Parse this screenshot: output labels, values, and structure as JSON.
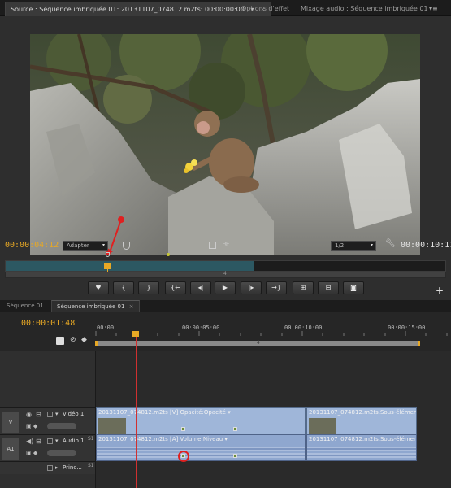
{
  "source_panel": {
    "tabs": [
      {
        "label": "Source : Séquence imbriquée 01: 20131107_074812.m2ts: 00:00:00:00",
        "active": true
      },
      {
        "label": "Options d'effet",
        "active": false
      },
      {
        "label": "Mixage audio : Séquence imbriquée 01",
        "active": false
      }
    ],
    "current_timecode": "00:00:04:12",
    "duration_timecode": "00:00:10:11",
    "zoom_select": "Adapter",
    "resolution_select": "1/2",
    "scrub_center_mark": "4",
    "icons": {
      "marker": "shield-marker-icon",
      "film": "film-icon",
      "split": "split-icon",
      "settings": "wrench-icon"
    }
  },
  "transport": {
    "buttons": [
      {
        "name": "add-marker-button",
        "glyph": "♥"
      },
      {
        "name": "mark-in-button",
        "glyph": "{"
      },
      {
        "name": "mark-out-button",
        "glyph": "}"
      },
      {
        "name": "go-to-in-button",
        "glyph": "{←"
      },
      {
        "name": "step-back-button",
        "glyph": "◂|"
      },
      {
        "name": "play-button",
        "glyph": "▶"
      },
      {
        "name": "step-forward-button",
        "glyph": "|▸"
      },
      {
        "name": "go-to-out-button",
        "glyph": "→}"
      },
      {
        "name": "insert-button",
        "glyph": "⊞"
      },
      {
        "name": "overwrite-button",
        "glyph": "⊟"
      },
      {
        "name": "export-frame-button",
        "glyph": "◙"
      }
    ],
    "add_button": "+"
  },
  "sequence_panel": {
    "tabs": [
      {
        "label": "Séquence 01",
        "active": false
      },
      {
        "label": "Séquence imbriquée 01",
        "active": true
      }
    ],
    "timecode": "00:00:01:48",
    "ruler": [
      "00:00",
      "00:00:05:00",
      "00:00:10:00",
      "00:00:15:00"
    ],
    "work_area_mark": "4",
    "tracks": {
      "video": {
        "source_label": "V",
        "name": "Vidéo 1",
        "clip1": "20131107_074812.m2ts [V]  Opacité:Opacité ▾",
        "clip2": "20131107_074812.m2ts.Sous-élément("
      },
      "audio": {
        "source_label": "A1",
        "name": "Audio 1",
        "clip1": "20131107_074812.m2ts [A]  Volume:Niveau ▾",
        "clip2": "20131107_074812.m2ts.Sous-élément("
      },
      "master": {
        "name": "Princ..."
      },
      "audio_badge": "S1",
      "master_badge": "S1"
    }
  },
  "colors": {
    "timecode": "#e7a825",
    "playhead": "#d03030",
    "video_clip": "#9fb6d9",
    "audio_clip": "#8fa7cf"
  }
}
